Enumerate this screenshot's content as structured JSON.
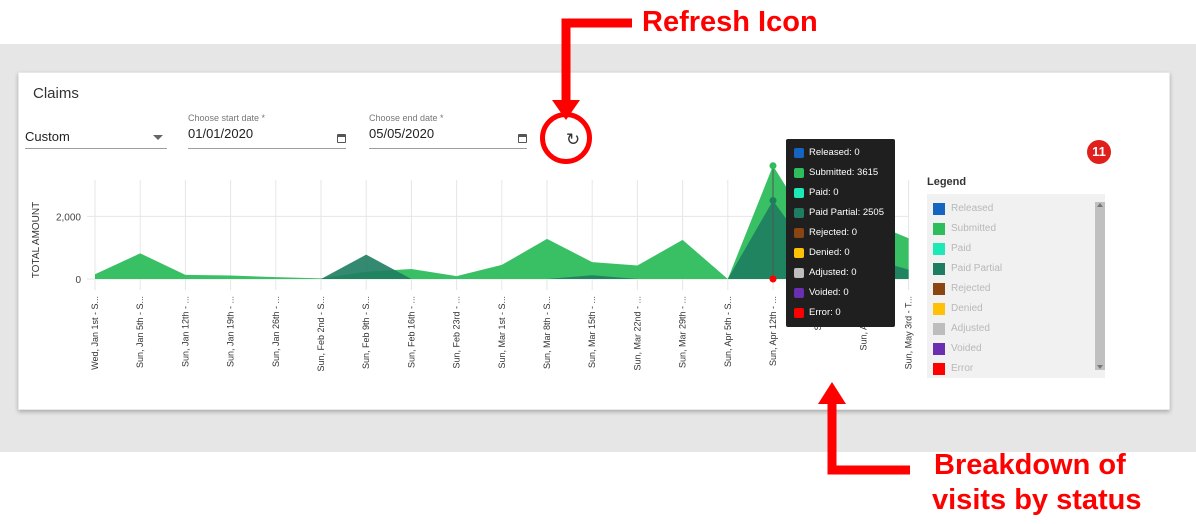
{
  "card": {
    "title": "Claims",
    "range_select": {
      "value": "Custom"
    },
    "start_date": {
      "label": "Choose start date *",
      "value": "01/01/2020"
    },
    "end_date": {
      "label": "Choose end date *",
      "value": "05/05/2020"
    },
    "refresh_icon": "refresh-icon",
    "badge": "11"
  },
  "annotations": {
    "refresh": "Refresh Icon",
    "breakdown_line1": "Breakdown of",
    "breakdown_line2": "visits by status",
    "color": "#ff0000"
  },
  "legend": {
    "title": "Legend",
    "items": [
      {
        "label": "Released",
        "color": "#1565c0"
      },
      {
        "label": "Submitted",
        "color": "#2ebd5c"
      },
      {
        "label": "Paid",
        "color": "#1de9b6"
      },
      {
        "label": "Paid Partial",
        "color": "#1e7d60"
      },
      {
        "label": "Rejected",
        "color": "#8b4513"
      },
      {
        "label": "Denied",
        "color": "#ffc107"
      },
      {
        "label": "Adjusted",
        "color": "#bdbdbd"
      },
      {
        "label": "Voided",
        "color": "#6a2fb0"
      },
      {
        "label": "Error",
        "color": "#ff0000"
      }
    ]
  },
  "tooltip": {
    "items": [
      {
        "text": "Released: 0",
        "color": "#1565c0"
      },
      {
        "text": "Submitted: 3615",
        "color": "#2ebd5c"
      },
      {
        "text": "Paid: 0",
        "color": "#1de9b6"
      },
      {
        "text": "Paid Partial: 2505",
        "color": "#1e7d60"
      },
      {
        "text": "Rejected: 0",
        "color": "#8b4513"
      },
      {
        "text": "Denied: 0",
        "color": "#ffc107"
      },
      {
        "text": "Adjusted: 0",
        "color": "#bdbdbd"
      },
      {
        "text": "Voided: 0",
        "color": "#6a2fb0"
      },
      {
        "text": "Error: 0",
        "color": "#ff0000"
      }
    ]
  },
  "chart_data": {
    "type": "area",
    "ylabel": "TOTAL AMOUNT",
    "yticks": [
      0,
      2000
    ],
    "ytick_labels": [
      "0",
      "2,000"
    ],
    "ylim": [
      0,
      3800
    ],
    "grid": true,
    "x": [
      "Wed, Jan 1st - S...",
      "Sun, Jan 5th - S...",
      "Sun, Jan 12th - ...",
      "Sun, Jan 19th - ...",
      "Sun, Jan 26th - ...",
      "Sun, Feb 2nd - S...",
      "Sun, Feb 9th - S...",
      "Sun, Feb 16th - ...",
      "Sun, Feb 23rd - ...",
      "Sun, Mar 1st - S...",
      "Sun, Mar 8th - S...",
      "Sun, Mar 15th - ...",
      "Sun, Mar 22nd - ...",
      "Sun, Mar 29th - ...",
      "Sun, Apr 5th - S...",
      "Sun, Apr 12th - ...",
      "Sun, Apr 19th - ...",
      "Sun, Apr 26th - ...",
      "Sun, May 3rd - T..."
    ],
    "visible_tick_label_indices": [
      0,
      1,
      2,
      3,
      4,
      5,
      6,
      7,
      8,
      9,
      10,
      11,
      12,
      13,
      14,
      15,
      17,
      18
    ],
    "visible_tick_labels_override": {
      "16": "Sun, Apr",
      "17": "Sun, Apr 26th"
    },
    "series": [
      {
        "name": "Submitted",
        "color": "#2ebd5c",
        "values": [
          150,
          820,
          130,
          110,
          60,
          20,
          230,
          320,
          90,
          450,
          1280,
          540,
          430,
          1250,
          0,
          3615,
          1300,
          1900,
          1300
        ]
      },
      {
        "name": "Paid Partial",
        "color": "#1e7d60",
        "values": [
          0,
          0,
          0,
          0,
          0,
          0,
          780,
          0,
          0,
          0,
          0,
          120,
          0,
          0,
          0,
          2505,
          500,
          700,
          300
        ]
      }
    ],
    "highlight_index": 15
  }
}
